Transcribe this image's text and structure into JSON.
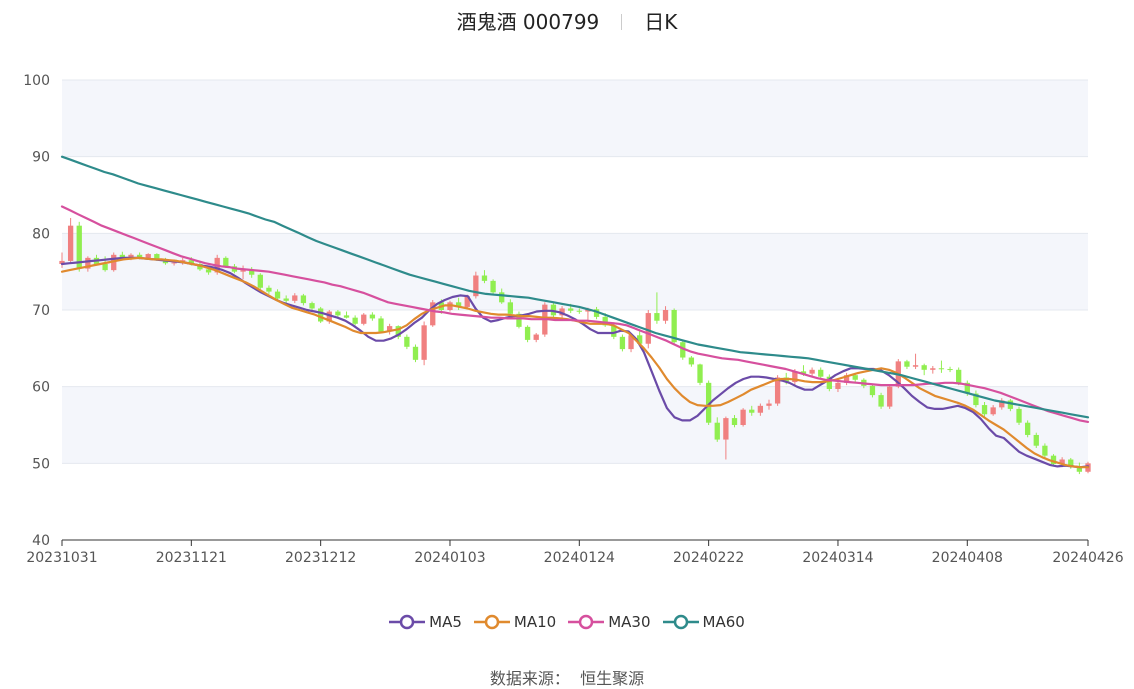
{
  "title": {
    "name": "酒鬼酒 000799",
    "period": "日K"
  },
  "source": {
    "label": "数据来源：",
    "value": "恒生聚源"
  },
  "colors": {
    "up": "#f08080",
    "down": "#90ee50",
    "MA5": "#6b4ba8",
    "MA10": "#e08a2e",
    "MA30": "#d6509e",
    "MA60": "#2e8b8b",
    "grid": "#e4e8ef",
    "band": "#f4f6fb"
  },
  "chart_data": {
    "type": "candlestick",
    "ylim": [
      40,
      100
    ],
    "yticks": [
      40,
      50,
      60,
      70,
      80,
      90,
      100
    ],
    "xticks": [
      "20231031",
      "20231121",
      "20231212",
      "20240103",
      "20240124",
      "20240222",
      "20240314",
      "20240408",
      "20240426"
    ],
    "xtick_index": [
      0,
      15,
      30,
      45,
      60,
      75,
      90,
      105,
      119
    ],
    "n_bars": 120,
    "ohlc": [
      [
        76.0,
        77.5,
        75.5,
        76.4
      ],
      [
        76.4,
        82.0,
        76.0,
        81.0
      ],
      [
        81.0,
        81.5,
        75.0,
        75.4
      ],
      [
        75.4,
        77.0,
        75.0,
        76.8
      ],
      [
        76.8,
        77.2,
        75.8,
        76.0
      ],
      [
        76.0,
        77.0,
        75.0,
        75.2
      ],
      [
        75.2,
        77.5,
        75.0,
        77.2
      ],
      [
        77.2,
        77.6,
        76.5,
        76.7
      ],
      [
        76.7,
        77.4,
        76.5,
        77.2
      ],
      [
        77.2,
        77.5,
        76.6,
        76.8
      ],
      [
        76.8,
        77.4,
        76.7,
        77.3
      ],
      [
        77.3,
        77.4,
        76.4,
        76.6
      ],
      [
        76.6,
        76.8,
        75.9,
        76.1
      ],
      [
        76.1,
        76.6,
        75.8,
        76.2
      ],
      [
        76.2,
        76.8,
        75.9,
        76.5
      ],
      [
        76.5,
        76.9,
        75.8,
        76.0
      ],
      [
        76.0,
        76.4,
        75.1,
        75.3
      ],
      [
        75.3,
        75.8,
        74.6,
        74.9
      ],
      [
        74.9,
        77.2,
        74.6,
        76.8
      ],
      [
        76.8,
        77.0,
        75.5,
        75.7
      ],
      [
        75.7,
        76.0,
        74.8,
        75.0
      ],
      [
        75.0,
        75.8,
        74.0,
        75.2
      ],
      [
        75.2,
        75.6,
        74.2,
        74.6
      ],
      [
        74.6,
        74.8,
        72.6,
        72.9
      ],
      [
        72.9,
        73.2,
        72.1,
        72.4
      ],
      [
        72.4,
        72.7,
        71.3,
        71.5
      ],
      [
        71.5,
        71.9,
        70.8,
        71.2
      ],
      [
        71.2,
        72.2,
        70.9,
        71.9
      ],
      [
        71.9,
        72.1,
        70.6,
        70.9
      ],
      [
        70.9,
        71.1,
        69.9,
        70.2
      ],
      [
        70.2,
        70.4,
        68.3,
        68.5
      ],
      [
        68.5,
        70.0,
        68.2,
        69.8
      ],
      [
        69.8,
        70.0,
        69.0,
        69.3
      ],
      [
        69.3,
        69.8,
        68.9,
        69.0
      ],
      [
        69.0,
        69.3,
        68.0,
        68.2
      ],
      [
        68.2,
        69.6,
        68.0,
        69.4
      ],
      [
        69.4,
        69.7,
        68.6,
        68.9
      ],
      [
        68.9,
        69.2,
        67.0,
        67.2
      ],
      [
        67.2,
        68.2,
        66.8,
        67.9
      ],
      [
        67.9,
        68.0,
        66.2,
        66.5
      ],
      [
        66.5,
        66.8,
        64.9,
        65.2
      ],
      [
        65.2,
        65.5,
        63.2,
        63.5
      ],
      [
        63.5,
        68.5,
        62.8,
        68.0
      ],
      [
        68.0,
        71.3,
        67.8,
        71.0
      ],
      [
        71.0,
        71.4,
        69.5,
        70.0
      ],
      [
        70.0,
        71.2,
        69.8,
        71.0
      ],
      [
        71.0,
        71.6,
        70.0,
        70.4
      ],
      [
        70.4,
        72.0,
        70.2,
        71.8
      ],
      [
        71.8,
        75.0,
        71.5,
        74.5
      ],
      [
        74.5,
        75.2,
        73.5,
        73.8
      ],
      [
        73.8,
        74.0,
        72.0,
        72.3
      ],
      [
        72.3,
        72.8,
        70.8,
        71.0
      ],
      [
        71.0,
        71.4,
        69.2,
        69.5
      ],
      [
        69.5,
        69.8,
        67.6,
        67.8
      ],
      [
        67.8,
        68.0,
        65.8,
        66.1
      ],
      [
        66.1,
        67.0,
        65.8,
        66.8
      ],
      [
        66.8,
        71.0,
        66.5,
        70.7
      ],
      [
        70.7,
        71.0,
        69.0,
        69.3
      ],
      [
        69.3,
        70.5,
        69.0,
        70.2
      ],
      [
        70.2,
        70.8,
        69.6,
        69.9
      ],
      [
        69.9,
        70.2,
        69.5,
        69.8
      ],
      [
        69.8,
        70.3,
        68.7,
        70.1
      ],
      [
        70.1,
        70.4,
        68.8,
        69.1
      ],
      [
        69.1,
        69.6,
        67.8,
        68.0
      ],
      [
        68.0,
        68.4,
        66.2,
        66.5
      ],
      [
        66.5,
        66.8,
        64.6,
        64.9
      ],
      [
        64.9,
        67.0,
        64.5,
        66.7
      ],
      [
        66.7,
        67.3,
        65.3,
        65.6
      ],
      [
        65.6,
        70.0,
        65.0,
        69.6
      ],
      [
        69.6,
        72.3,
        68.2,
        68.6
      ],
      [
        68.6,
        70.5,
        68.2,
        70.0
      ],
      [
        70.0,
        70.2,
        65.5,
        65.8
      ],
      [
        65.8,
        66.0,
        63.5,
        63.8
      ],
      [
        63.8,
        64.0,
        62.6,
        62.9
      ],
      [
        62.9,
        63.0,
        60.2,
        60.5
      ],
      [
        60.5,
        60.8,
        55.0,
        55.3
      ],
      [
        55.3,
        56.0,
        52.8,
        53.1
      ],
      [
        53.1,
        56.1,
        50.5,
        55.9
      ],
      [
        55.9,
        56.3,
        54.7,
        55.0
      ],
      [
        55.0,
        57.2,
        54.8,
        57.0
      ],
      [
        57.0,
        57.5,
        56.2,
        56.6
      ],
      [
        56.6,
        57.8,
        56.2,
        57.5
      ],
      [
        57.5,
        58.3,
        57.0,
        57.8
      ],
      [
        57.8,
        61.5,
        57.5,
        61.2
      ],
      [
        61.2,
        61.8,
        60.3,
        60.6
      ],
      [
        60.6,
        62.3,
        60.2,
        62.0
      ],
      [
        62.0,
        62.8,
        61.4,
        61.7
      ],
      [
        61.7,
        62.5,
        61.2,
        62.2
      ],
      [
        62.2,
        62.5,
        61.0,
        61.3
      ],
      [
        61.3,
        61.6,
        59.4,
        59.7
      ],
      [
        59.7,
        60.8,
        59.3,
        60.5
      ],
      [
        60.5,
        61.8,
        60.2,
        61.5
      ],
      [
        61.5,
        61.8,
        60.6,
        60.9
      ],
      [
        60.9,
        61.1,
        59.8,
        60.1
      ],
      [
        60.1,
        60.3,
        58.6,
        58.9
      ],
      [
        58.9,
        59.2,
        57.1,
        57.4
      ],
      [
        57.4,
        60.3,
        57.1,
        60.0
      ],
      [
        60.0,
        63.6,
        59.8,
        63.3
      ],
      [
        63.3,
        63.5,
        62.3,
        62.6
      ],
      [
        62.6,
        64.3,
        62.3,
        62.8
      ],
      [
        62.8,
        63.0,
        61.5,
        62.2
      ],
      [
        62.2,
        62.7,
        61.7,
        62.4
      ],
      [
        62.4,
        63.4,
        61.8,
        62.3
      ],
      [
        62.3,
        62.6,
        61.9,
        62.2
      ],
      [
        62.2,
        62.5,
        60.2,
        60.5
      ],
      [
        60.5,
        60.8,
        58.8,
        59.1
      ],
      [
        59.1,
        59.5,
        57.3,
        57.6
      ],
      [
        57.6,
        58.0,
        56.1,
        56.4
      ],
      [
        56.4,
        57.6,
        56.2,
        57.3
      ],
      [
        57.3,
        58.5,
        57.0,
        58.2
      ],
      [
        58.2,
        58.4,
        56.8,
        57.1
      ],
      [
        57.1,
        57.4,
        55.0,
        55.3
      ],
      [
        55.3,
        55.6,
        53.4,
        53.7
      ],
      [
        53.7,
        54.0,
        52.0,
        52.3
      ],
      [
        52.3,
        52.6,
        50.7,
        51.0
      ],
      [
        51.0,
        51.2,
        49.6,
        49.9
      ],
      [
        49.9,
        50.8,
        49.5,
        50.5
      ],
      [
        50.5,
        50.7,
        49.3,
        49.6
      ],
      [
        49.6,
        50.1,
        48.6,
        48.9
      ],
      [
        48.9,
        50.2,
        48.7,
        50.0
      ]
    ],
    "series": [
      {
        "name": "MA5",
        "values": [
          76.0,
          76.1,
          76.2,
          76.3,
          76.4,
          76.5,
          76.6,
          76.7,
          76.8,
          76.8,
          76.8,
          76.7,
          76.6,
          76.5,
          76.4,
          76.3,
          76.2,
          76.0,
          75.8,
          75.7,
          75.5,
          75.2,
          74.8,
          74.2,
          73.5,
          72.9,
          72.3,
          71.8,
          71.3,
          70.9,
          70.6,
          70.3,
          70.0,
          69.8,
          69.6,
          69.3,
          69.0,
          68.6,
          68.0,
          67.3,
          66.5,
          66.0,
          66.0,
          66.3,
          66.8,
          67.5,
          68.3,
          69.0,
          70.0,
          70.8,
          71.3,
          71.7,
          71.9,
          71.8,
          70.2,
          69.0,
          68.5,
          68.7,
          69.0,
          69.2,
          69.3,
          69.5,
          69.8,
          69.9,
          69.9,
          69.7,
          69.3,
          68.8,
          68.2,
          67.5,
          67.0,
          67.0,
          67.0,
          67.3,
          67.2,
          66.2,
          64.5,
          62.0,
          59.5,
          57.2,
          56.0,
          55.6,
          55.6,
          56.2,
          57.2,
          58.2,
          59.0,
          59.8,
          60.5,
          61.0,
          61.3,
          61.3,
          61.2,
          61.0,
          60.8,
          60.5,
          60.0,
          59.6,
          59.6,
          60.2,
          60.8,
          61.5,
          62.0,
          62.4,
          62.4,
          62.3,
          62.3,
          62.1,
          61.5,
          60.7,
          59.8,
          58.8,
          58.0,
          57.3,
          57.1,
          57.1,
          57.3,
          57.5,
          57.2,
          56.7,
          55.8,
          54.6,
          53.6,
          53.3,
          52.4,
          51.5,
          51.0,
          50.6,
          50.2,
          49.8,
          49.6,
          49.7,
          49.6,
          49.5,
          49.6
        ]
      },
      {
        "name": "MA10",
        "values": [
          75.0,
          75.2,
          75.4,
          75.6,
          75.8,
          76.0,
          76.2,
          76.4,
          76.6,
          76.7,
          76.8,
          76.7,
          76.6,
          76.6,
          76.5,
          76.4,
          76.2,
          76.0,
          75.8,
          75.5,
          75.2,
          74.8,
          74.4,
          74.0,
          73.6,
          73.1,
          72.5,
          71.9,
          71.3,
          70.8,
          70.3,
          70.0,
          69.7,
          69.4,
          69.0,
          68.6,
          68.2,
          67.8,
          67.3,
          67.0,
          67.0,
          67.0,
          67.1,
          67.3,
          67.5,
          68.0,
          68.8,
          69.5,
          70.0,
          70.3,
          70.6,
          70.6,
          70.4,
          70.2,
          69.9,
          69.7,
          69.5,
          69.4,
          69.4,
          69.3,
          69.2,
          69.2,
          69.1,
          69.0,
          69.0,
          68.9,
          68.8,
          68.6,
          68.4,
          68.2,
          68.2,
          68.2,
          68.0,
          67.5,
          67.0,
          66.0,
          65.0,
          63.8,
          62.5,
          61.0,
          59.8,
          58.8,
          58.0,
          57.6,
          57.5,
          57.5,
          57.6,
          58.0,
          58.5,
          59.0,
          59.6,
          60.0,
          60.4,
          60.8,
          61.0,
          61.0,
          60.9,
          60.7,
          60.6,
          60.6,
          60.7,
          60.9,
          61.2,
          61.5,
          61.8,
          62.0,
          62.2,
          62.4,
          62.2,
          61.8,
          61.2,
          60.5,
          59.8,
          59.3,
          58.8,
          58.5,
          58.2,
          57.9,
          57.5,
          57.0,
          56.3,
          55.6,
          55.0,
          54.4,
          53.6,
          52.8,
          52.0,
          51.3,
          50.8,
          50.4,
          50.1,
          49.8,
          49.6,
          49.5,
          49.5
        ]
      },
      {
        "name": "MA30",
        "values": [
          83.5,
          83.0,
          82.5,
          82.0,
          81.5,
          81.0,
          80.6,
          80.2,
          79.8,
          79.4,
          79.0,
          78.6,
          78.2,
          77.8,
          77.4,
          77.0,
          76.7,
          76.4,
          76.1,
          75.9,
          75.7,
          75.6,
          75.4,
          75.3,
          75.2,
          75.1,
          75.0,
          74.8,
          74.6,
          74.4,
          74.2,
          74.0,
          73.8,
          73.6,
          73.3,
          73.1,
          72.8,
          72.5,
          72.2,
          71.8,
          71.4,
          71.0,
          70.8,
          70.6,
          70.4,
          70.2,
          70.0,
          69.8,
          69.7,
          69.5,
          69.4,
          69.3,
          69.2,
          69.1,
          69.0,
          69.0,
          68.9,
          68.9,
          68.9,
          68.8,
          68.8,
          68.8,
          68.7,
          68.7,
          68.7,
          68.6,
          68.6,
          68.5,
          68.4,
          68.3,
          68.2,
          68.0,
          67.6,
          67.2,
          66.8,
          66.4,
          66.0,
          65.5,
          65.0,
          64.6,
          64.3,
          64.1,
          63.9,
          63.7,
          63.6,
          63.5,
          63.3,
          63.1,
          62.9,
          62.7,
          62.5,
          62.3,
          62.0,
          61.7,
          61.4,
          61.1,
          60.9,
          60.8,
          60.7,
          60.6,
          60.5,
          60.4,
          60.3,
          60.2,
          60.2,
          60.2,
          60.2,
          60.2,
          60.3,
          60.4,
          60.4,
          60.5,
          60.5,
          60.4,
          60.2,
          60.0,
          59.8,
          59.5,
          59.2,
          58.8,
          58.4,
          58.0,
          57.6,
          57.2,
          56.8,
          56.5,
          56.2,
          55.9,
          55.6,
          55.4
        ]
      },
      {
        "name": "MA60",
        "values": [
          90.0,
          89.6,
          89.2,
          88.8,
          88.4,
          88.0,
          87.7,
          87.3,
          86.9,
          86.5,
          86.2,
          85.9,
          85.6,
          85.3,
          85.0,
          84.7,
          84.4,
          84.1,
          83.8,
          83.5,
          83.2,
          82.9,
          82.6,
          82.2,
          81.8,
          81.5,
          81.0,
          80.5,
          80.0,
          79.5,
          79.0,
          78.6,
          78.2,
          77.8,
          77.4,
          77.0,
          76.6,
          76.2,
          75.8,
          75.4,
          75.0,
          74.6,
          74.3,
          74.0,
          73.7,
          73.4,
          73.1,
          72.8,
          72.5,
          72.3,
          72.1,
          72.0,
          71.9,
          71.8,
          71.7,
          71.6,
          71.4,
          71.2,
          71.0,
          70.8,
          70.6,
          70.4,
          70.1,
          69.8,
          69.4,
          69.0,
          68.6,
          68.2,
          67.8,
          67.4,
          67.0,
          66.7,
          66.4,
          66.1,
          65.8,
          65.5,
          65.3,
          65.1,
          64.9,
          64.7,
          64.5,
          64.4,
          64.3,
          64.2,
          64.1,
          64.0,
          63.9,
          63.8,
          63.7,
          63.5,
          63.3,
          63.1,
          62.9,
          62.7,
          62.5,
          62.3,
          62.1,
          61.9,
          61.7,
          61.5,
          61.2,
          60.9,
          60.6,
          60.3,
          60.0,
          59.7,
          59.4,
          59.1,
          58.8,
          58.5,
          58.2,
          58.0,
          57.8,
          57.6,
          57.4,
          57.2,
          57.0,
          56.8,
          56.6,
          56.4,
          56.2,
          56.0
        ]
      }
    ]
  }
}
